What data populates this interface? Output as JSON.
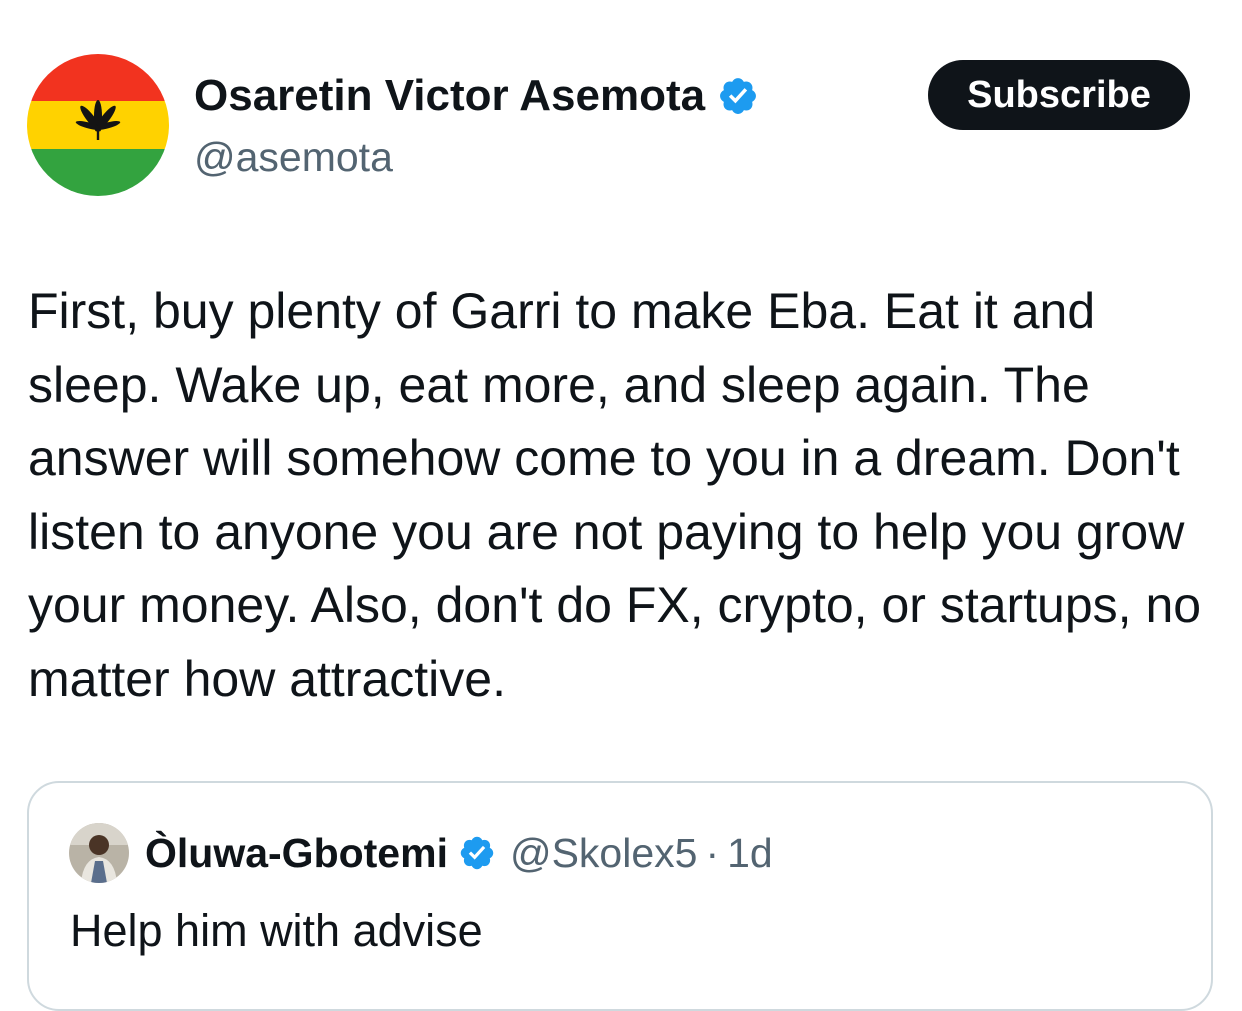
{
  "author": {
    "display_name": "Osaretin Victor Asemota",
    "handle": "@asemota",
    "avatar_icon": "flag-leaf-avatar",
    "verified": true
  },
  "actions": {
    "subscribe_label": "Subscribe"
  },
  "tweet": {
    "text": "First, buy plenty of Garri to make Eba. Eat it and sleep. Wake up, eat more, and sleep again. The answer will somehow come to you in a dream. Don't listen to anyone you are not paying to help you grow your money. Also, don't do FX, crypto, or startups, no matter how attractive."
  },
  "quoted_tweet": {
    "display_name": "Òluwa-Gbotemi",
    "handle": "@Skolex5",
    "separator": "·",
    "time": "1d",
    "verified": true,
    "text": "Help him with advise"
  },
  "colors": {
    "verified_blue": "#1d9bf0",
    "text_primary": "#0f1419",
    "text_secondary": "#536471",
    "border": "#cfd9de",
    "flag_red": "#f2331f",
    "flag_yellow": "#ffd200",
    "flag_green": "#33a33f"
  }
}
